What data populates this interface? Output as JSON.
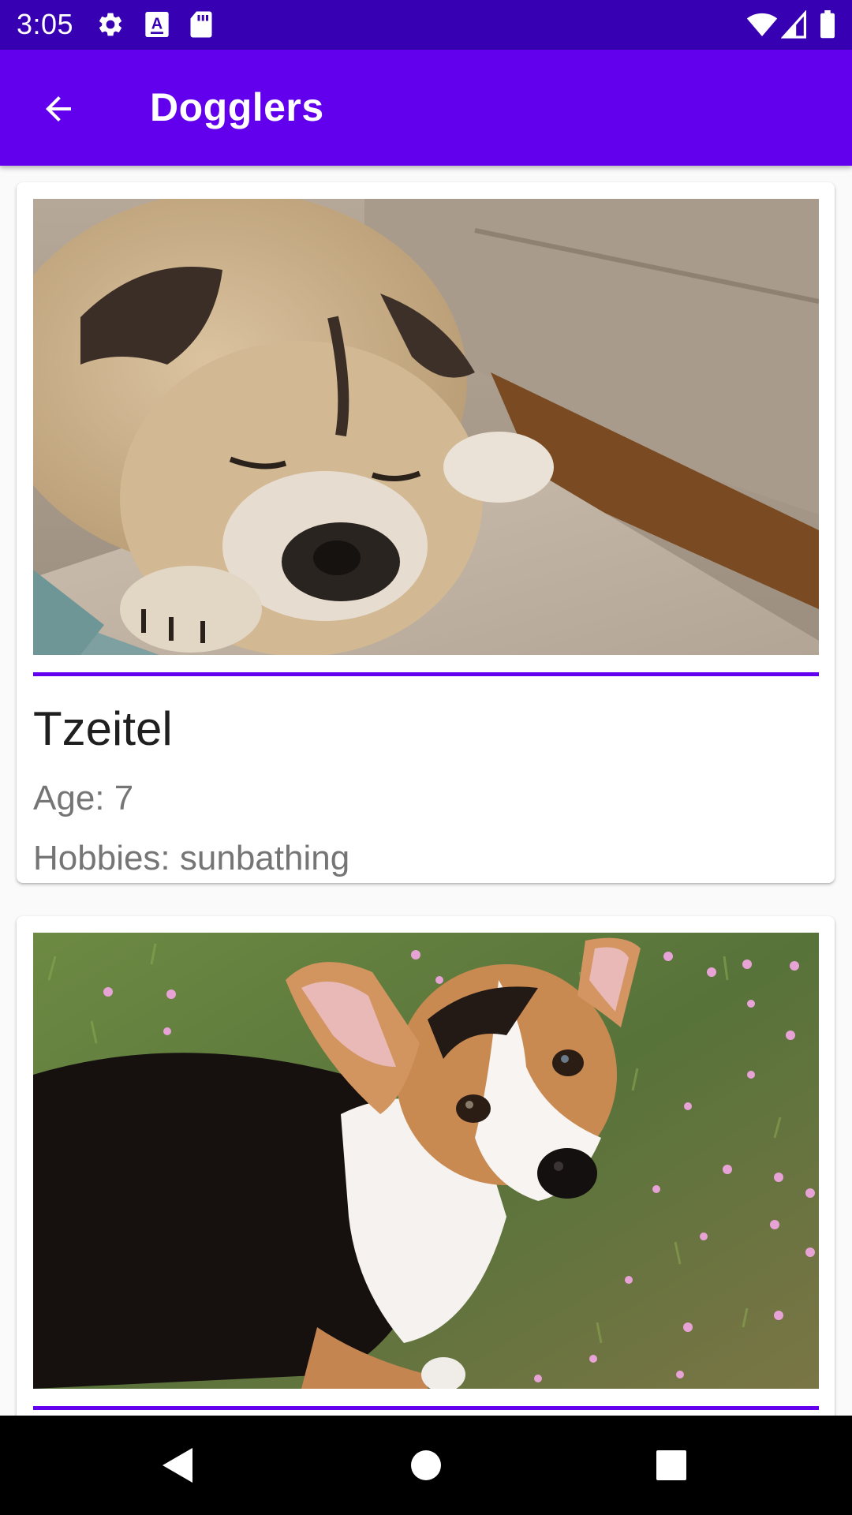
{
  "status_bar": {
    "time": "3:05",
    "icons": [
      "gear-icon",
      "text-a-icon",
      "sd-card-icon",
      "wifi-icon",
      "signal-icon",
      "battery-icon"
    ]
  },
  "app_bar": {
    "title": "Dogglers",
    "back_icon": "arrow-back-icon",
    "color": "#6200ee"
  },
  "dogs": [
    {
      "name": "Tzeitel",
      "age": "Age: 7",
      "hobbies": "Hobbies: sunbathing",
      "photo": "pug-sleeping-on-couch"
    },
    {
      "name": "",
      "age": "",
      "hobbies": "",
      "photo": "corgi-on-grass"
    }
  ],
  "nav_bar": {
    "buttons": [
      "back-triangle-icon",
      "home-circle-icon",
      "recents-square-icon"
    ]
  },
  "colors": {
    "status_bar": "#3700b3",
    "primary": "#6200ee",
    "secondary_text": "#757575"
  }
}
